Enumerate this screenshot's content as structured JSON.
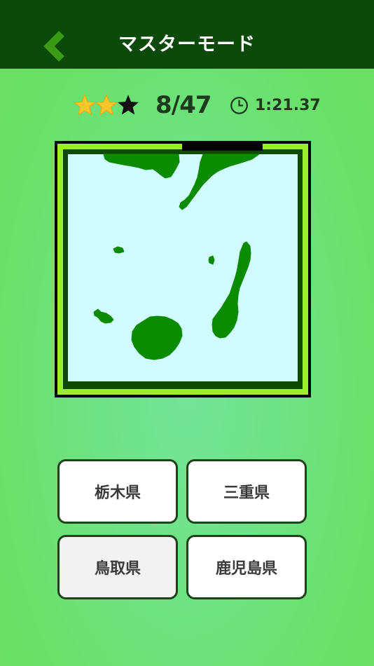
{
  "header": {
    "title": "マスターモード",
    "back_icon": "chevron-left-icon"
  },
  "stats": {
    "stars_earned": 2,
    "stars_total": 3,
    "progress": "8/47",
    "timer": "1:21.37"
  },
  "quiz": {
    "question_image": "prefecture-silhouette-islands",
    "answers": [
      {
        "label": "栃木県"
      },
      {
        "label": "三重県"
      },
      {
        "label": "鳥取県"
      },
      {
        "label": "鹿児島県"
      }
    ]
  },
  "colors": {
    "header_bg": "#0c4a0a",
    "accent_green": "#3a9a14",
    "land": "#0b8b00",
    "sea": "#d0fcff",
    "frame_lime": "#9aef2c",
    "frame_dark": "#0e4a00",
    "star_gold": "#f7c62a"
  }
}
